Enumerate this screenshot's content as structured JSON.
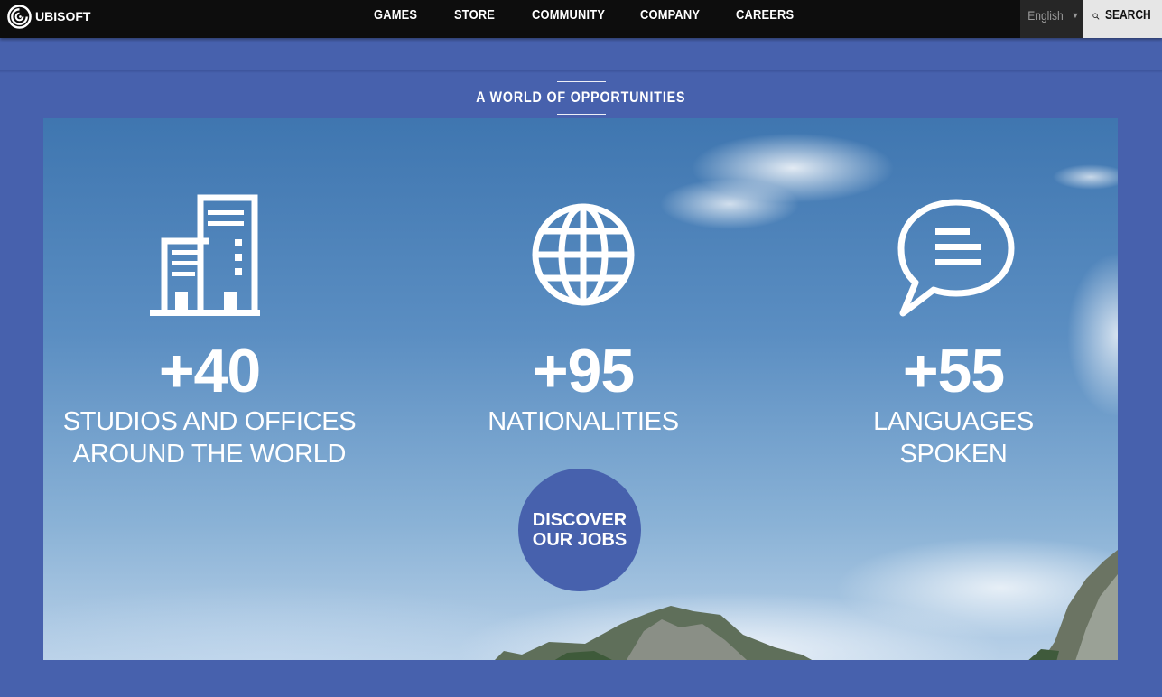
{
  "header": {
    "logo_text": "UBISOFT",
    "nav": [
      "GAMES",
      "STORE",
      "COMMUNITY",
      "COMPANY",
      "CAREERS"
    ],
    "language": "English",
    "search_label": "SEARCH"
  },
  "section": {
    "title": "A WORLD OF OPPORTUNITIES"
  },
  "stats": [
    {
      "icon": "buildings-icon",
      "number": "+40",
      "label_line1": "STUDIOS AND OFFICES",
      "label_line2": "AROUND THE WORLD"
    },
    {
      "icon": "globe-icon",
      "number": "+95",
      "label_line1": "NATIONALITIES",
      "label_line2": ""
    },
    {
      "icon": "speech-bubble-icon",
      "number": "+55",
      "label_line1": "LANGUAGES",
      "label_line2": "SPOKEN"
    }
  ],
  "cta": {
    "line1": "DISCOVER",
    "line2": "OUR JOBS"
  },
  "colors": {
    "brand_blue": "#4761ad",
    "nav_bg": "#0d0d0d",
    "search_bg": "#e6e6e6"
  }
}
